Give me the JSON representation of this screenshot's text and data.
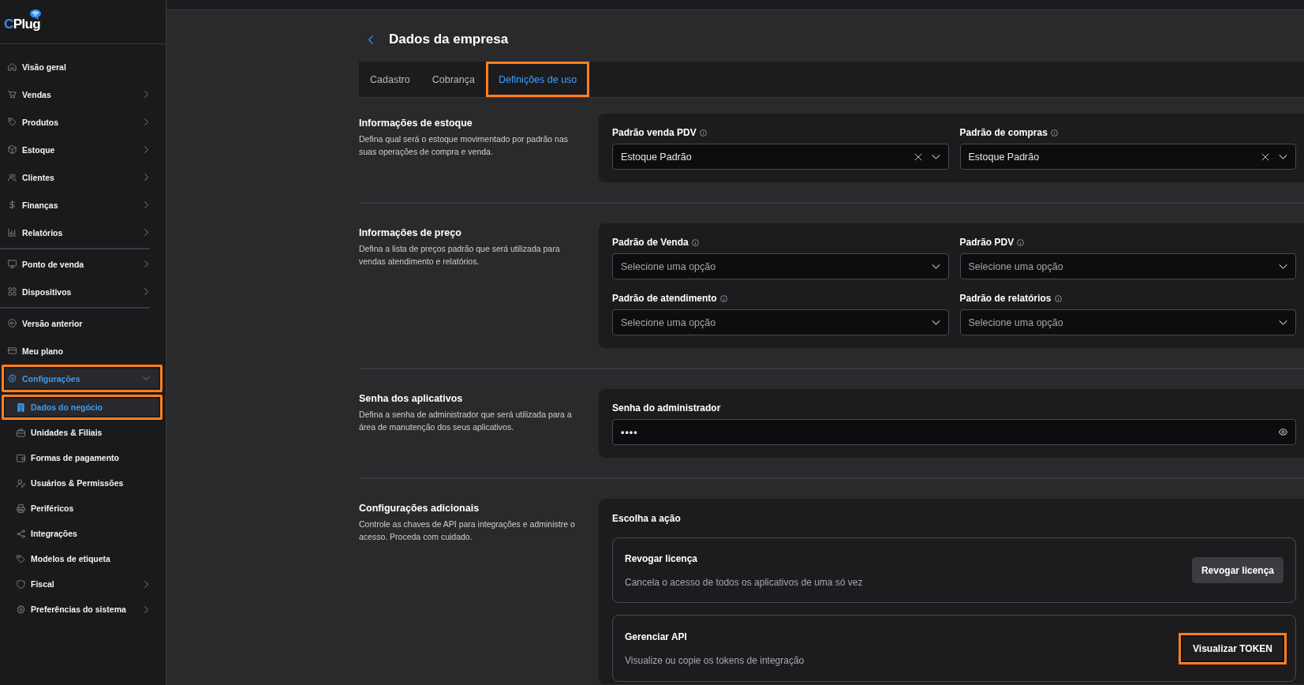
{
  "sidebar": {
    "logo": {
      "accent": "C",
      "rest": "Plug"
    },
    "groups": [
      {
        "items": [
          {
            "label": "Visão geral",
            "submenu": false,
            "expanded": false,
            "selected": false,
            "highlighted": false
          },
          {
            "label": "Vendas",
            "submenu": true,
            "expanded": false,
            "selected": false,
            "highlighted": false
          },
          {
            "label": "Produtos",
            "submenu": true,
            "expanded": false,
            "selected": false,
            "highlighted": false
          },
          {
            "label": "Estoque",
            "submenu": true,
            "expanded": false,
            "selected": false,
            "highlighted": false
          },
          {
            "label": "Clientes",
            "submenu": true,
            "expanded": false,
            "selected": false,
            "highlighted": false
          },
          {
            "label": "Finanças",
            "submenu": true,
            "expanded": false,
            "selected": false,
            "highlighted": false
          },
          {
            "label": "Relatórios",
            "submenu": true,
            "expanded": false,
            "selected": false,
            "highlighted": false
          }
        ]
      },
      {
        "items": [
          {
            "label": "Ponto de venda",
            "submenu": true,
            "expanded": false,
            "selected": false,
            "highlighted": false
          },
          {
            "label": "Dispositivos",
            "submenu": true,
            "expanded": false,
            "selected": false,
            "highlighted": false
          }
        ]
      },
      {
        "items": [
          {
            "label": "Versão anterior",
            "submenu": false,
            "expanded": false,
            "selected": false,
            "highlighted": false
          },
          {
            "label": "Meu plano",
            "submenu": false,
            "expanded": false,
            "selected": false,
            "highlighted": false
          },
          {
            "label": "Configurações",
            "submenu": true,
            "expanded": true,
            "selected": true,
            "highlighted": true,
            "children": [
              {
                "label": "Dados do negócio",
                "submenu": false,
                "selected": true,
                "highlighted": true
              },
              {
                "label": "Unidades & Filiais",
                "submenu": false,
                "selected": false,
                "highlighted": false
              },
              {
                "label": "Formas de pagamento",
                "submenu": false,
                "selected": false,
                "highlighted": false
              },
              {
                "label": "Usuários & Permissões",
                "submenu": false,
                "selected": false,
                "highlighted": false
              },
              {
                "label": "Periféricos",
                "submenu": false,
                "selected": false,
                "highlighted": false
              },
              {
                "label": "Integrações",
                "submenu": false,
                "selected": false,
                "highlighted": false
              },
              {
                "label": "Modelos de etiqueta",
                "submenu": false,
                "selected": false,
                "highlighted": false
              },
              {
                "label": "Fiscal",
                "submenu": true,
                "selected": false,
                "highlighted": false
              },
              {
                "label": "Preferências do sistema",
                "submenu": true,
                "selected": false,
                "highlighted": false
              }
            ]
          }
        ]
      }
    ]
  },
  "page": {
    "title": "Dados da empresa",
    "tabs": [
      {
        "label": "Cadastro",
        "selected": false,
        "highlighted": false
      },
      {
        "label": "Cobrança",
        "selected": false,
        "highlighted": false
      },
      {
        "label": "Definições de uso",
        "selected": true,
        "highlighted": true
      }
    ],
    "sections": [
      {
        "kind": "selects",
        "title": "Informações de estoque",
        "description": "Defina qual será o estoque movimentado por padrão nas suas operações de compra e venda.",
        "fields": [
          {
            "label": "Padrão venda PDV",
            "info": true,
            "value": "Estoque Padrão",
            "clearable": true
          },
          {
            "label": "Padrão de compras",
            "info": true,
            "value": "Estoque Padrão",
            "clearable": true
          }
        ]
      },
      {
        "kind": "selects",
        "title": "Informações de preço",
        "description": "Defina a lista de preços padrão que será utilizada para vendas atendimento e relatórios.",
        "fields": [
          {
            "label": "Padrão de Venda",
            "info": true,
            "placeholder": "Selecione uma opção",
            "clearable": false
          },
          {
            "label": "Padrão PDV",
            "info": true,
            "placeholder": "Selecione uma opção",
            "clearable": false
          },
          {
            "label": "Padrão de atendimento",
            "info": true,
            "placeholder": "Selecione uma opção",
            "clearable": false
          },
          {
            "label": "Padrão de relatórios",
            "info": true,
            "placeholder": "Selecione uma opção",
            "clearable": false
          }
        ]
      },
      {
        "kind": "password",
        "title": "Senha dos aplicativos",
        "description": "Defina a senha de administrador que será utilizada para a área de manutenção dos seus aplicativos.",
        "field": {
          "label": "Senha do administrador",
          "value": "••••"
        }
      },
      {
        "kind": "actions",
        "title": "Configurações adicionais",
        "description": "Controle as chaves de API para integrações e administre o acesso. Proceda com cuidado.",
        "heading": "Escolha a ação",
        "actions": [
          {
            "title": "Revogar licença",
            "description": "Cancela o acesso de todos os aplicativos de uma só vez",
            "button": "Revogar licença",
            "highlighted": false
          },
          {
            "title": "Gerenciar API",
            "description": "Visualize ou copie os tokens de integração",
            "button": "Visualizar TOKEN",
            "highlighted": true
          }
        ]
      }
    ]
  }
}
